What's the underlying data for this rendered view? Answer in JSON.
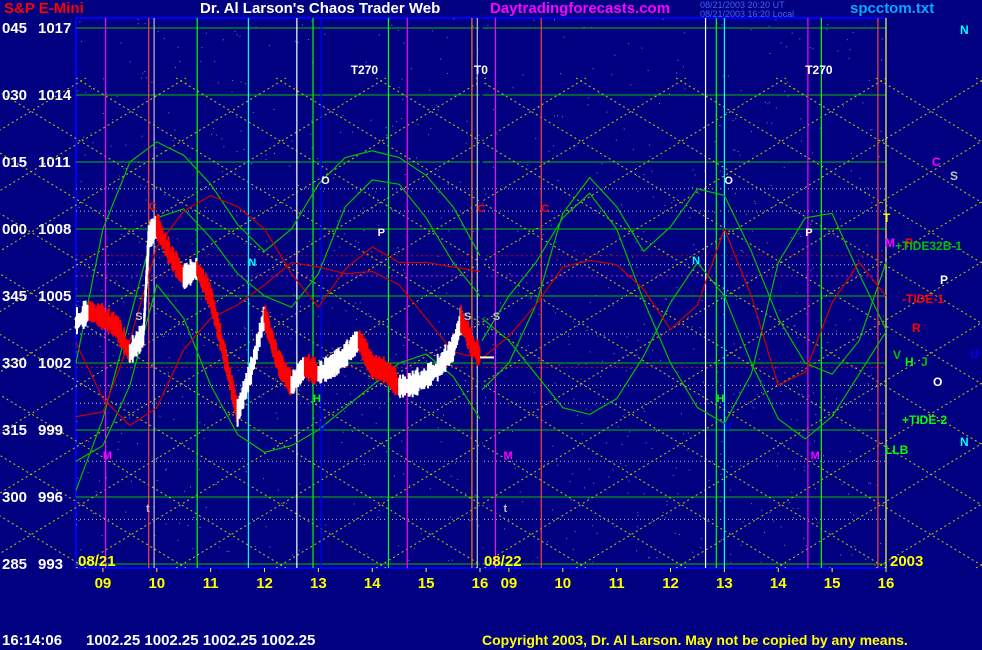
{
  "header": {
    "symbol": "S&P E-Mini",
    "title": "Dr. Al Larson's Chaos Trader Web",
    "site": "Daytradingforecasts.com",
    "stamp_line1": "08/21/2003 20:20 UT",
    "stamp_line2": "08/21/2003 16:20 Local",
    "filename": "spcctom.txt"
  },
  "footer": {
    "time": "16:14:06",
    "quote": "1002.25 1002.25 1002.25 1002.25",
    "copyright": "Copyright 2003, Dr. Al Larson. May not be copied by any means."
  },
  "colors": {
    "background": "#000080",
    "grid_green": "#00c000",
    "grid_white_dots": "#c0c0c0",
    "tide_green": "#00c000",
    "tide_red": "#cc0000",
    "bar_up": "#ffffff",
    "bar_down": "#ff0000",
    "magenta": "#ff00ff",
    "cyan": "#00ffff",
    "yellow": "#ffff00"
  },
  "chart_data": {
    "type": "line",
    "title": "S&P E-Mini",
    "y_left_labels": [
      {
        "tick": "045",
        "price": 1017
      },
      {
        "tick": "030",
        "price": 1014
      },
      {
        "tick": "015",
        "price": 1011
      },
      {
        "tick": "000",
        "price": 1008
      },
      {
        "tick": "345",
        "price": 1005
      },
      {
        "tick": "330",
        "price": 1002
      },
      {
        "tick": "315",
        "price": 999
      },
      {
        "tick": "300",
        "price": 996
      },
      {
        "tick": "285",
        "price": 993
      }
    ],
    "ylim": [
      993,
      1017
    ],
    "x_hour_labels": [
      "09",
      "10",
      "11",
      "12",
      "13",
      "14",
      "15",
      "16",
      "09",
      "10",
      "11",
      "12",
      "13",
      "14",
      "15",
      "16"
    ],
    "date_labels": [
      "08/21",
      "08/22"
    ],
    "year_label": "2003",
    "timing_labels": [
      "T270",
      "T0",
      "T270"
    ],
    "chart_markers": [
      "C",
      "S",
      "N",
      "H",
      "M",
      "t",
      "O",
      "P",
      "V",
      "C",
      "S",
      "N",
      "H",
      "M",
      "t",
      "O",
      "P",
      "V",
      "C",
      "S",
      "M"
    ],
    "right_labels": [
      {
        "text": "N",
        "color": "#00ffff"
      },
      {
        "text": "C",
        "color": "#ff00ff"
      },
      {
        "text": "S",
        "color": "#c0c0c0"
      },
      {
        "text": "T",
        "color": "#ffff00"
      },
      {
        "text": "M",
        "color": "#ff00ff"
      },
      {
        "text": "P",
        "color": "#ff0000"
      },
      {
        "text": "+TIDE32B-1",
        "color": "#00c000"
      },
      {
        "text": "P",
        "color": "#ffffff"
      },
      {
        "text": "-TIDE-1",
        "color": "#ff0000"
      },
      {
        "text": "R",
        "color": "#ff0000"
      },
      {
        "text": "V",
        "color": "#00c000"
      },
      {
        "text": "H",
        "color": "#00ff00"
      },
      {
        "text": "J",
        "color": "#00c000"
      },
      {
        "text": "U",
        "color": "#0000ff"
      },
      {
        "text": "O",
        "color": "#ffffff"
      },
      {
        "text": "+TIDE-2",
        "color": "#00ff00"
      },
      {
        "text": "N",
        "color": "#00ffff"
      },
      {
        "text": "LLB",
        "color": "#00ff00"
      }
    ],
    "price_series": [
      {
        "hour": 8.5,
        "price": 1003.8
      },
      {
        "hour": 8.75,
        "price": 1004.3
      },
      {
        "hour": 9.0,
        "price": 1004.0
      },
      {
        "hour": 9.25,
        "price": 1003.6
      },
      {
        "hour": 9.5,
        "price": 1002.4
      },
      {
        "hour": 9.75,
        "price": 1003.2
      },
      {
        "hour": 9.85,
        "price": 1007.6
      },
      {
        "hour": 10.0,
        "price": 1008.1
      },
      {
        "hour": 10.25,
        "price": 1006.8
      },
      {
        "hour": 10.5,
        "price": 1005.8
      },
      {
        "hour": 10.75,
        "price": 1006.2
      },
      {
        "hour": 11.0,
        "price": 1004.9
      },
      {
        "hour": 11.25,
        "price": 1002.4
      },
      {
        "hour": 11.5,
        "price": 999.7
      },
      {
        "hour": 11.75,
        "price": 1001.6
      },
      {
        "hour": 12.0,
        "price": 1004.1
      },
      {
        "hour": 12.25,
        "price": 1002.0
      },
      {
        "hour": 12.5,
        "price": 1001.0
      },
      {
        "hour": 12.75,
        "price": 1001.8
      },
      {
        "hour": 13.0,
        "price": 1001.5
      },
      {
        "hour": 13.25,
        "price": 1001.8
      },
      {
        "hour": 13.5,
        "price": 1002.3
      },
      {
        "hour": 13.75,
        "price": 1003.0
      },
      {
        "hour": 14.0,
        "price": 1001.8
      },
      {
        "hour": 14.25,
        "price": 1001.6
      },
      {
        "hour": 14.5,
        "price": 1000.9
      },
      {
        "hour": 14.75,
        "price": 1001.0
      },
      {
        "hour": 15.0,
        "price": 1001.3
      },
      {
        "hour": 15.25,
        "price": 1001.8
      },
      {
        "hour": 15.5,
        "price": 1002.6
      },
      {
        "hour": 15.65,
        "price": 1003.9
      },
      {
        "hour": 15.85,
        "price": 1002.8
      },
      {
        "hour": 16.0,
        "price": 1002.25
      }
    ]
  }
}
